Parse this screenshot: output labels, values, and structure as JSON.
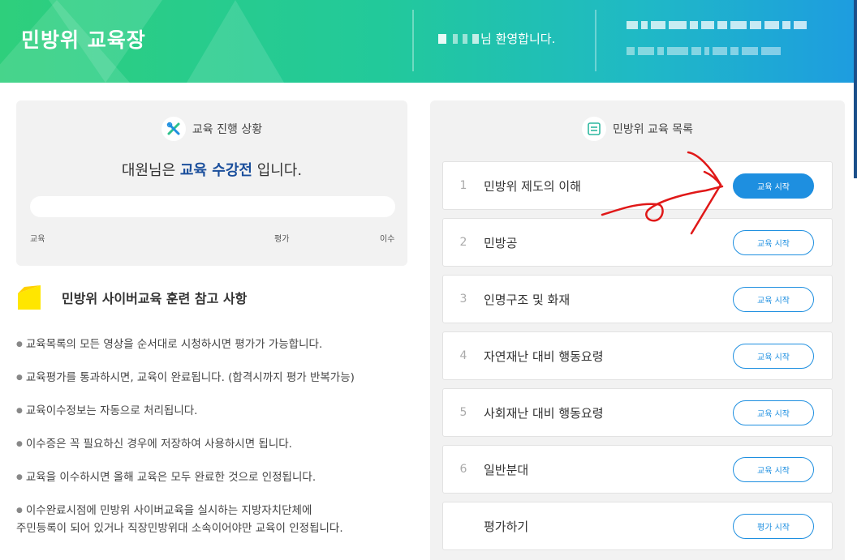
{
  "header": {
    "title": "민방위 교육장",
    "welcome_suffix": "님 환영합니다."
  },
  "progress": {
    "heading": "교육 진행 상황",
    "status_prefix": "대원님은",
    "status_highlight": "교육 수강전",
    "status_suffix": "입니다.",
    "percent": 0,
    "stages": [
      "교육",
      "평가",
      "이수"
    ]
  },
  "reference": {
    "title": "민방위 사이버교육 훈련 참고 사항",
    "notes": [
      "교육목록의 모든 영상을 순서대로 시청하시면 평가가 가능합니다.",
      "교육평가를 통과하시면, 교육이 완료됩니다. (합격시까지 평가 반복가능)",
      "교육이수정보는 자동으로 처리됩니다.",
      "이수증은 꼭 필요하신 경우에 저장하여 사용하시면 됩니다.",
      "교육을 이수하시면 올해 교육은 모두 완료한 것으로 인정됩니다.",
      "이수완료시점에 민방위 사이버교육을 실시하는 지방자치단체에\n주민등록이 되어 있거나 직장민방위대 소속이어야만 교육이 인정됩니다."
    ]
  },
  "courses": {
    "heading": "민방위 교육 목록",
    "items": [
      {
        "num": "1",
        "name": "민방위 제도의 이해",
        "button": "교육 시작"
      },
      {
        "num": "2",
        "name": "민방공",
        "button": "교육 시작"
      },
      {
        "num": "3",
        "name": "인명구조 및 화재",
        "button": "교육 시작"
      },
      {
        "num": "4",
        "name": "자연재난 대비 행동요령",
        "button": "교육 시작"
      },
      {
        "num": "5",
        "name": "사회재난 대비 행동요령",
        "button": "교육 시작"
      },
      {
        "num": "6",
        "name": "일반분대",
        "button": "교육 시작"
      },
      {
        "num": "",
        "name": "평가하기",
        "button": "평가 시작"
      }
    ]
  },
  "colors": {
    "accent": "#1e8fe0",
    "highlight": "#1b4f9c",
    "annotation": "#e01818"
  },
  "icons": {
    "progress_icon": "tools-icon",
    "list_icon": "document-list-icon",
    "note_icon": "sticky-note-icon"
  }
}
